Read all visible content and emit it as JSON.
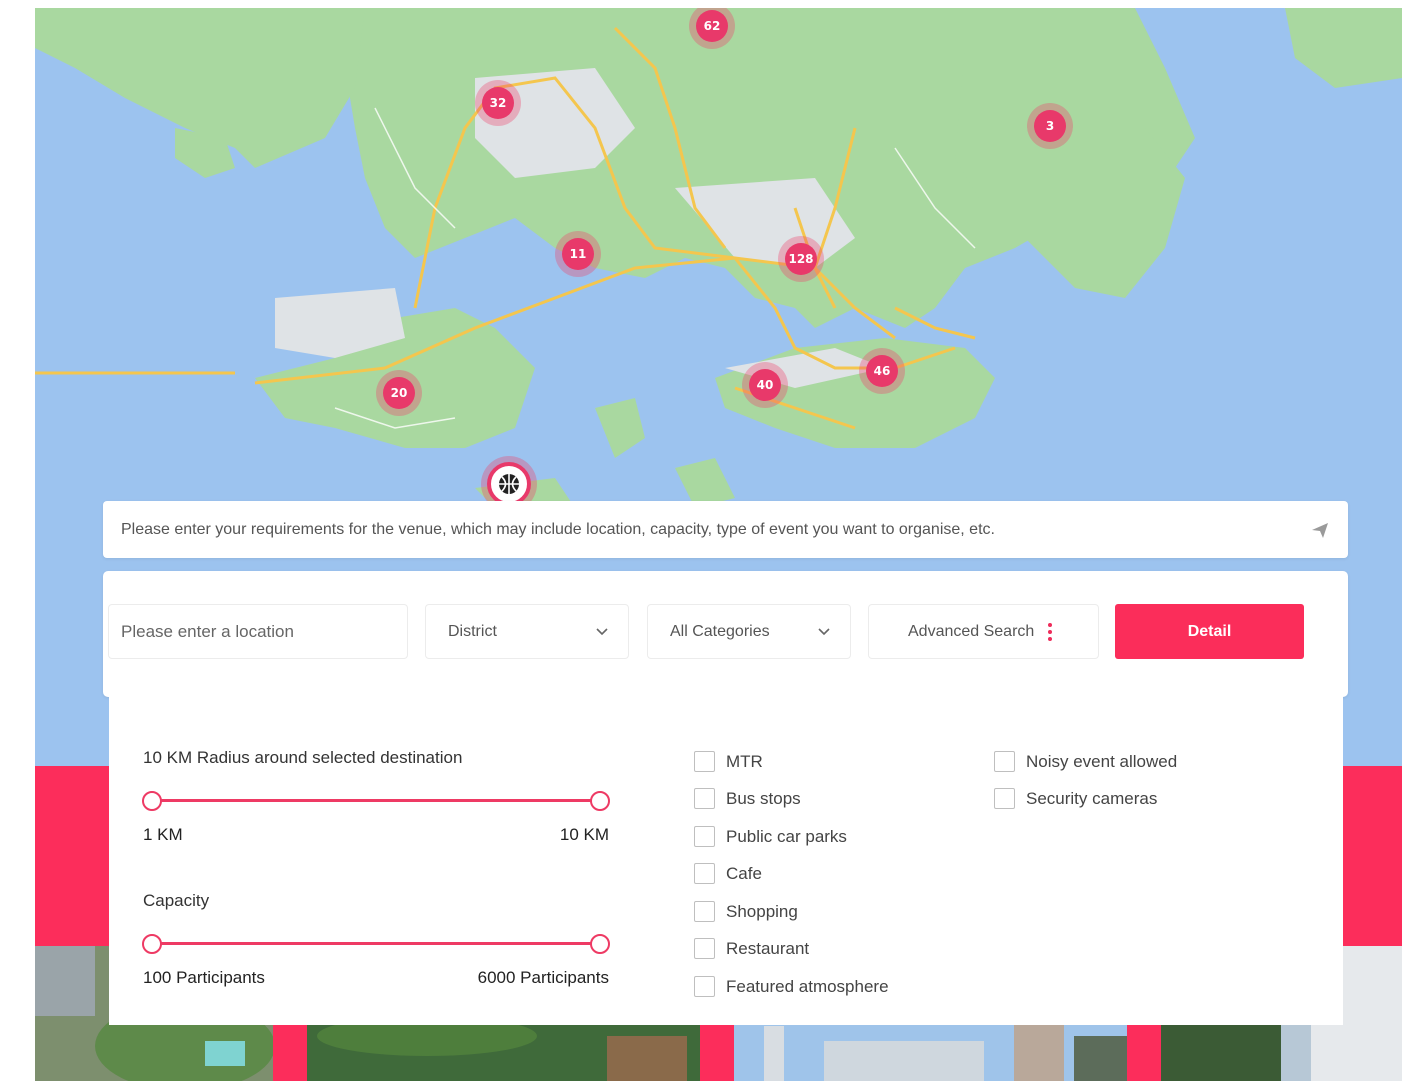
{
  "map": {
    "clusters": [
      {
        "id": "c62",
        "count": "62"
      },
      {
        "id": "c32",
        "count": "32"
      },
      {
        "id": "c3",
        "count": "3"
      },
      {
        "id": "c11",
        "count": "11"
      },
      {
        "id": "c128",
        "count": "128"
      },
      {
        "id": "c46",
        "count": "46"
      },
      {
        "id": "c40",
        "count": "40"
      },
      {
        "id": "c20",
        "count": "20"
      }
    ],
    "venue_icon": "basketball-icon"
  },
  "prompt": {
    "placeholder": "Please enter your requirements for the venue, which may include location, capacity, type of event you want to organise, etc.",
    "send_icon": "send-icon"
  },
  "search": {
    "location_placeholder": "Please enter a location",
    "district_label": "District",
    "category_label": "All Categories",
    "advanced_label": "Advanced Search",
    "detail_label": "Detail"
  },
  "advanced": {
    "radius": {
      "label": "10 KM Radius around selected destination",
      "min_label": "1 KM",
      "max_label": "10 KM",
      "min_value": 1,
      "max_value": 10
    },
    "capacity": {
      "label": "Capacity",
      "min_label": "100 Participants",
      "max_label": "6000 Participants",
      "min_value": 100,
      "max_value": 6000
    },
    "facilities": [
      {
        "label": "MTR",
        "checked": false
      },
      {
        "label": "Bus stops",
        "checked": false
      },
      {
        "label": "Public car parks",
        "checked": false
      },
      {
        "label": "Cafe",
        "checked": false
      },
      {
        "label": "Shopping",
        "checked": false
      },
      {
        "label": "Restaurant",
        "checked": false
      },
      {
        "label": "Featured atmosphere",
        "checked": false
      }
    ],
    "extras": [
      {
        "label": "Noisy event allowed",
        "checked": false
      },
      {
        "label": "Security cameras",
        "checked": false
      }
    ]
  },
  "colors": {
    "accent": "#fb2d5a",
    "cluster": "#e8396a",
    "sea": "#9cc3ef",
    "land": "#a9d8a0",
    "road": "#f4c64e"
  }
}
